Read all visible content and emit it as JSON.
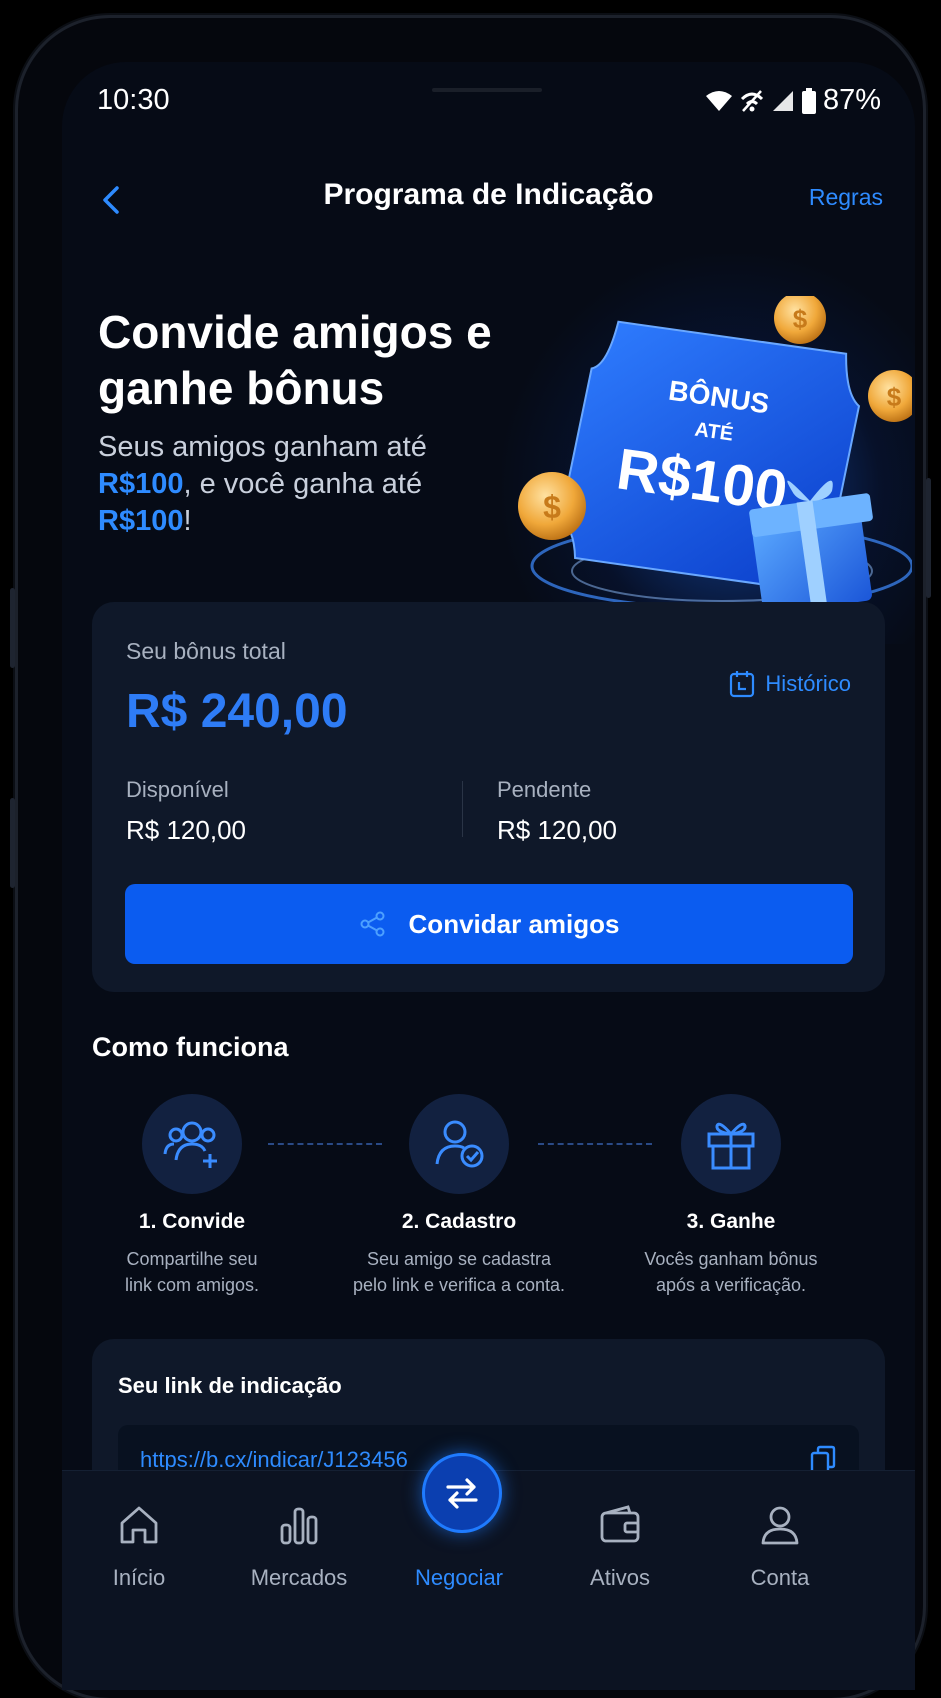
{
  "status_bar": {
    "time": "10:30",
    "battery": "87%"
  },
  "header": {
    "title": "Programa de Indicação",
    "rules_label": "Regras"
  },
  "hero": {
    "headline": "Convide amigos e ganhe bônus",
    "text_1": "Seus amigos ganham até ",
    "amount_1": "R$100",
    "text_2": ", e você ganha até ",
    "amount_2": "R$100",
    "text_3": "!",
    "ticket_line_1": "BÔNUS",
    "ticket_line_2": "ATÉ",
    "ticket_amount": "R$100"
  },
  "bonus_card": {
    "label": "Seu bônus total",
    "total": "R$ 240,00",
    "history_label": "Histórico",
    "available_label": "Disponível",
    "available_value": "R$ 120,00",
    "pending_label": "Pendente",
    "pending_value": "R$ 120,00",
    "invite_label": "Convidar amigos"
  },
  "how_it_works": {
    "title": "Como funciona",
    "steps": [
      {
        "title": "1. Convide",
        "desc_1": "Compartilhe seu",
        "desc_2": "link com amigos.",
        "icon": "users-add-icon"
      },
      {
        "title": "2. Cadastro",
        "desc_1": "Seu amigo se cadastra",
        "desc_2": "pelo link e verifica a conta.",
        "icon": "user-check-icon"
      },
      {
        "title": "3. Ganhe",
        "desc_1": "Vocês ganham bônus",
        "desc_2": "após a verificação.",
        "icon": "gift-icon"
      }
    ]
  },
  "referral_link": {
    "title": "Seu link de indicação",
    "url": "https://b.cx/indicar/J123456"
  },
  "bottom_nav": {
    "items": [
      {
        "label": "Início",
        "icon": "home-icon"
      },
      {
        "label": "Mercados",
        "icon": "bar-chart-icon"
      },
      {
        "label": "Negociar",
        "icon": "swap-icon",
        "active": true
      },
      {
        "label": "Ativos",
        "icon": "wallet-icon"
      },
      {
        "label": "Conta",
        "icon": "user-icon"
      }
    ]
  },
  "colors": {
    "accent": "#2e8bff",
    "button": "#0b5cf0",
    "background": "#060b16",
    "card": "#0f1829"
  }
}
